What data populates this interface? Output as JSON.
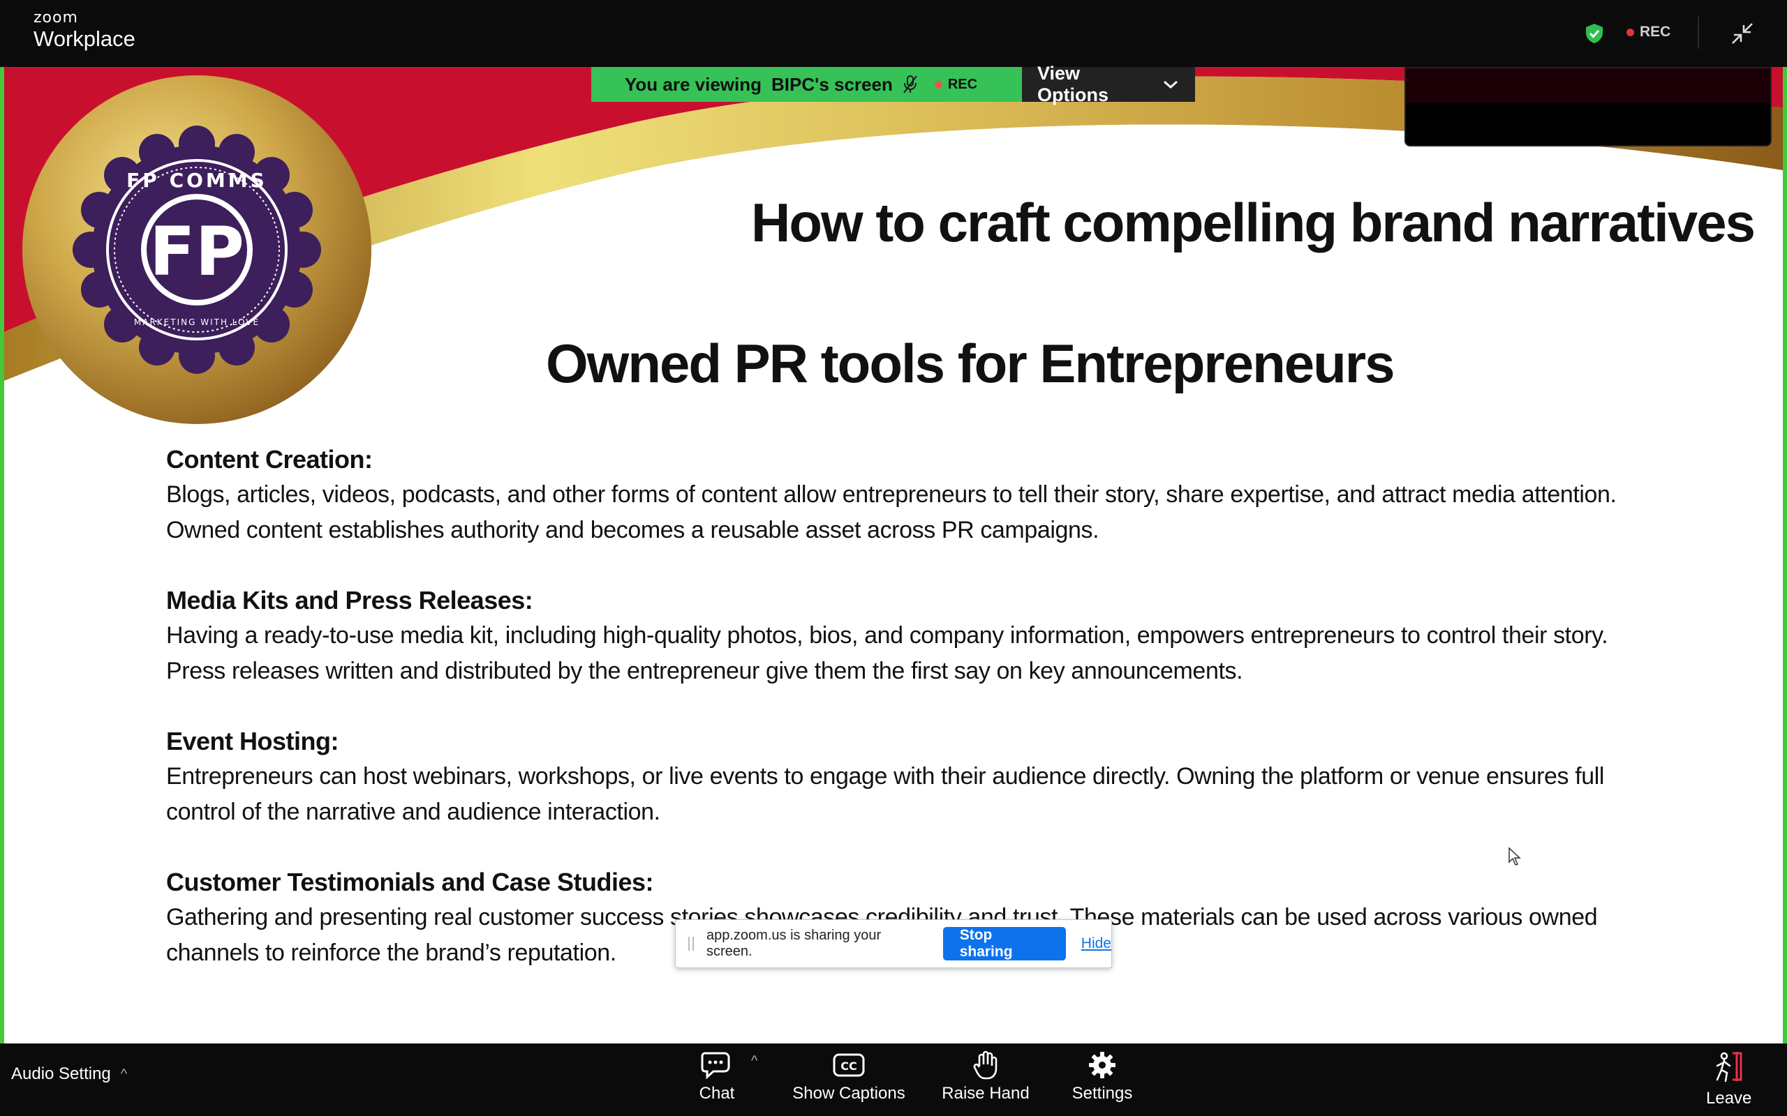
{
  "app": {
    "brand_small": "zoom",
    "brand_name": "Workplace",
    "rec_label": "REC"
  },
  "banner": {
    "viewing_prefix": "You are viewing",
    "viewing_name": "BIPC's screen",
    "rec_label": "REC",
    "view_options_label": "View Options"
  },
  "slide": {
    "logo_top_text": "FP COMMS",
    "logo_bottom_text": "MARKETING WITH LOVE",
    "title": "How to craft compelling brand narratives",
    "subtitle": "Owned PR tools for Entrepreneurs",
    "sections": [
      {
        "heading": "Content Creation:",
        "lines": [
          "Blogs, articles, videos, podcasts, and other forms of content allow entrepreneurs to tell their story, share expertise, and attract media attention.",
          "Owned content establishes authority and becomes a reusable asset across PR campaigns."
        ]
      },
      {
        "heading": "Media Kits and Press Releases:",
        "lines": [
          "Having a ready-to-use media kit, including high-quality photos, bios, and company information, empowers entrepreneurs to control their story.",
          "Press releases written and distributed by the entrepreneur give them the first say on key announcements."
        ]
      },
      {
        "heading": "Event Hosting:",
        "lines": [
          "Entrepreneurs can host webinars, workshops, or live events to engage with their audience directly. Owning the platform or venue ensures full",
          "control of the narrative and audience interaction."
        ]
      },
      {
        "heading": "Customer Testimonials and Case Studies:",
        "lines": [
          "Gathering and presenting real customer success stories showcases credibility and trust. These materials can be used across various owned",
          "channels to reinforce the brand’s reputation."
        ]
      }
    ]
  },
  "share_notice": {
    "text": "app.zoom.us is sharing your screen.",
    "stop_label": "Stop sharing",
    "hide_label": "Hide"
  },
  "toolbar": {
    "audio_label": "Audio Setting",
    "chat_label": "Chat",
    "captions_label": "Show Captions",
    "raise_hand_label": "Raise Hand",
    "settings_label": "Settings",
    "leave_label": "Leave"
  },
  "colors": {
    "slide_red": "#c8102e",
    "slide_gold": "#c9a94a",
    "seal_purple": "#3d1f5c",
    "share_border_green": "#45c83a",
    "banner_green": "#36c257",
    "zoom_blue": "#0e72ed"
  },
  "icons": [
    "shield-check-icon",
    "collapse-icon",
    "chat-icon",
    "cc-icon",
    "hand-icon",
    "gear-icon",
    "leave-icon",
    "mic-off-icon",
    "chevron-down-icon",
    "cursor-icon"
  ]
}
